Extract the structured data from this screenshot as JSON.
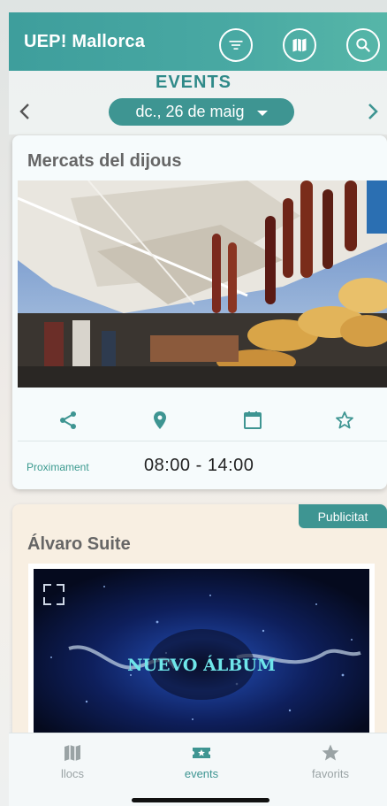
{
  "header": {
    "title": "UEP! Mallorca",
    "filter_icon": "filter-icon",
    "map_icon": "map-icon",
    "search_icon": "search-icon",
    "color": "#45a6a1"
  },
  "events": {
    "section_title": "EVENTS",
    "date": "dc., 26 de maig",
    "prev_icon": "chevron-left-icon",
    "next_icon": "chevron-right-icon"
  },
  "event_card": {
    "title": "Mercats del dijous",
    "status": "Proximament",
    "time": "08:00 - 14:00",
    "actions": [
      "share-icon",
      "location-pin-icon",
      "calendar-icon",
      "star-outline-icon"
    ]
  },
  "ad_card": {
    "badge": "Publicitat",
    "title": "Álvaro Suite",
    "image_text": "NUEVO ÁLBUM",
    "expand_icon": "expand-icon"
  },
  "tabbar": {
    "tabs": [
      {
        "label": "llocs",
        "icon": "map-icon",
        "active": false
      },
      {
        "label": "events",
        "icon": "ticket-star-icon",
        "active": true
      },
      {
        "label": "favorits",
        "icon": "star-icon",
        "active": false
      }
    ],
    "active_color": "#3e9592",
    "inactive_color": "#9aa3a5"
  }
}
